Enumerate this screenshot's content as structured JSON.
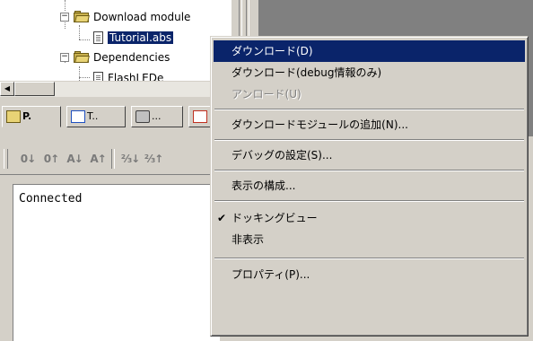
{
  "tree": {
    "items": [
      {
        "label": "Download module",
        "type": "folder",
        "expanded": true
      },
      {
        "label": "Tutorial.abs",
        "type": "file",
        "selected": true
      },
      {
        "label": "Dependencies",
        "type": "folder",
        "expanded": true
      },
      {
        "label": "FlashLEDe",
        "type": "file",
        "selected": false
      }
    ]
  },
  "tabs": [
    {
      "label": "P.",
      "active": true
    },
    {
      "label": "T..",
      "active": false
    },
    {
      "label": "...",
      "active": false
    }
  ],
  "output": {
    "text": "Connected"
  },
  "context_menu": {
    "items": [
      {
        "label": "ダウンロード(D)",
        "state": "highlight"
      },
      {
        "label": "ダウンロード(debug情報のみ)",
        "state": "normal"
      },
      {
        "label": "アンロード(U)",
        "state": "disabled"
      },
      {
        "label": "ダウンロードモジュールの追加(N)...",
        "state": "normal"
      },
      {
        "label": "デバッグの設定(S)...",
        "state": "normal"
      },
      {
        "label": "表示の構成...",
        "state": "normal"
      },
      {
        "label": "ドッキングビュー",
        "state": "checked"
      },
      {
        "label": "非表示",
        "state": "normal"
      },
      {
        "label": "プロパティ(P)...",
        "state": "normal"
      }
    ]
  },
  "colors": {
    "highlight": "#0a246a",
    "face": "#d4d0c8",
    "folder": "#e8d375"
  }
}
